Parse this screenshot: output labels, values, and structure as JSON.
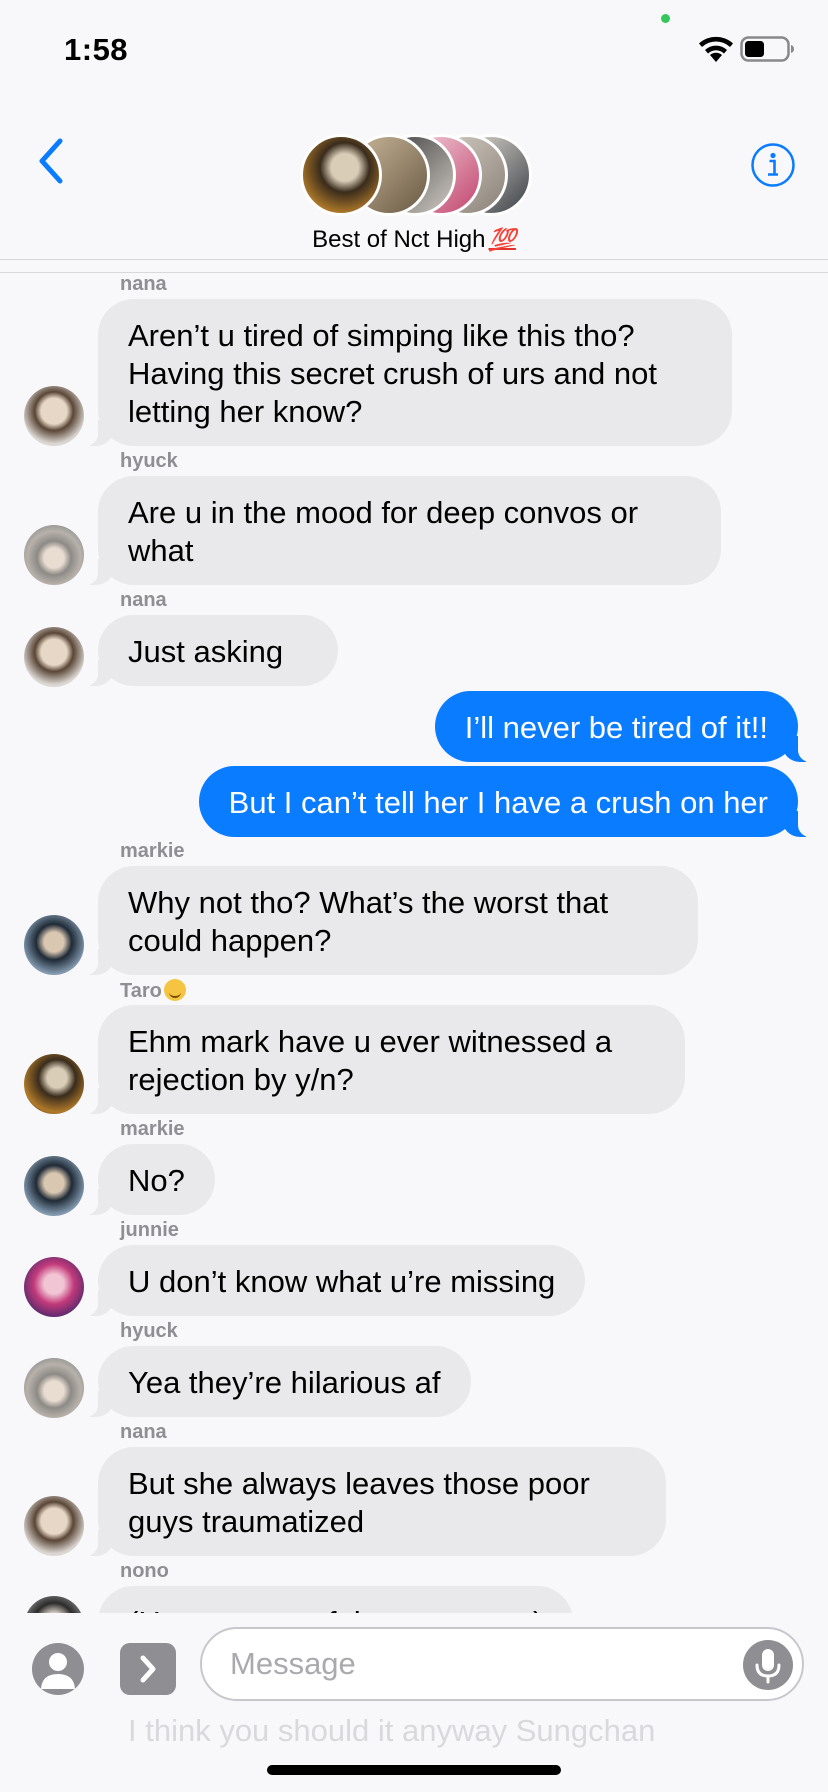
{
  "status_bar": {
    "time": "1:58"
  },
  "header": {
    "group_name": "Best of Nct High",
    "group_emoji": "💯",
    "back_icon": "chevron-left-icon",
    "info_icon": "info-icon"
  },
  "messages": [
    {
      "sender": "nana",
      "text": "Aren’t  u tired of simping like this tho? Having this secret crush of urs and not letting her know?",
      "direction": "in"
    },
    {
      "sender": "hyuck",
      "text": "Are u in the mood for deep convos or what",
      "direction": "in"
    },
    {
      "sender": "nana",
      "text": "Just asking",
      "direction": "in"
    },
    {
      "sender": "",
      "text": "I’ll never be tired of it!!",
      "direction": "out"
    },
    {
      "sender": "",
      "text": "But I can’t tell her I have a crush on her",
      "direction": "out"
    },
    {
      "sender": "markie",
      "text": "Why not tho? What’s the worst that could happen?",
      "direction": "in"
    },
    {
      "sender": "Taro",
      "text": "Ehm mark have u ever witnessed a rejection by y/n?",
      "direction": "in"
    },
    {
      "sender": "markie",
      "text": "No?",
      "direction": "in"
    },
    {
      "sender": "junnie",
      "text": "U don’t know what u’re missing",
      "direction": "in"
    },
    {
      "sender": "hyuck",
      "text": "Yea they’re hilarious af",
      "direction": "in"
    },
    {
      "sender": "nana",
      "text": "But she always leaves those poor guys traumatized",
      "direction": "in"
    },
    {
      "sender": "nono",
      "text": "(He was one of the poor guys)",
      "direction": "in"
    }
  ],
  "compose": {
    "placeholder": "Message",
    "ghost_text": "I think you should it anyway Sungchan"
  },
  "colors": {
    "outgoing_bubble": "#0a7cff",
    "incoming_bubble": "#e9e9eb",
    "accent": "#0a7cff"
  }
}
